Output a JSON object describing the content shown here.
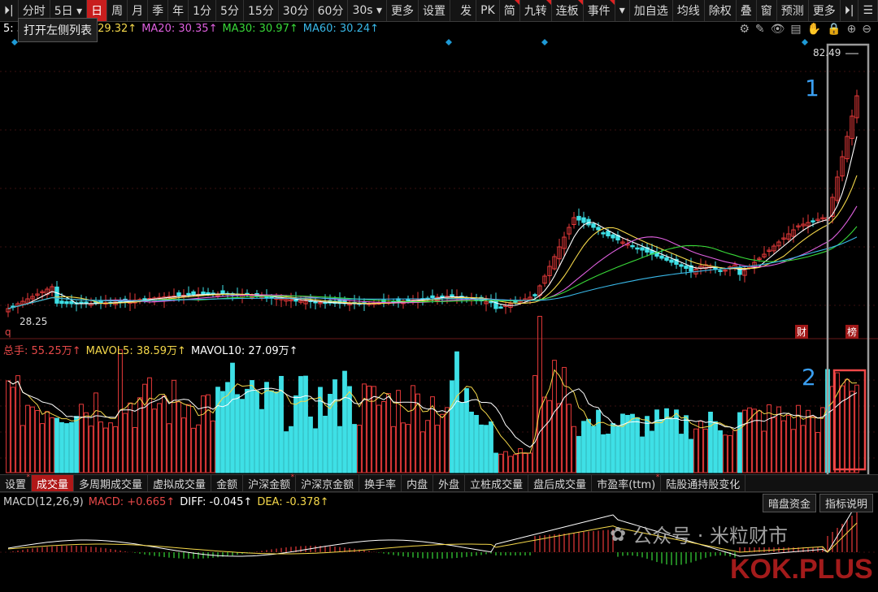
{
  "toolbar": {
    "items": [
      {
        "label": "⏵|",
        "kind": "icon"
      },
      {
        "label": "分时"
      },
      {
        "label": "5日 ▾"
      },
      {
        "label": "日",
        "active": true
      },
      {
        "label": "周"
      },
      {
        "label": "月"
      },
      {
        "label": "季"
      },
      {
        "label": "年"
      },
      {
        "label": "1分"
      },
      {
        "label": "5分"
      },
      {
        "label": "15分"
      },
      {
        "label": "30分"
      },
      {
        "label": "60分"
      },
      {
        "label": "30s ▾"
      },
      {
        "label": "更多"
      },
      {
        "label": "设置"
      }
    ],
    "right_items": [
      {
        "label": "发"
      },
      {
        "label": "PK"
      },
      {
        "label": "简",
        "corner": true
      },
      {
        "label": "九转",
        "corner": true
      },
      {
        "label": "连板",
        "corner": true
      },
      {
        "label": "事件",
        "corner": true
      },
      {
        "label": "▾"
      },
      {
        "label": "加自选"
      },
      {
        "label": "均线"
      },
      {
        "label": "除权"
      },
      {
        "label": "叠"
      },
      {
        "label": "窗"
      },
      {
        "label": "预测"
      },
      {
        "label": "更多"
      },
      {
        "label": "⏵|"
      },
      {
        "label": "☰"
      }
    ]
  },
  "tooltip": "打开左侧列表",
  "ma_legend": {
    "ma5": "5: 30.60↑",
    "ma10": "MA10: 29.32↑",
    "ma20": "MA20: 30.35↑",
    "ma30": "MA30: 30.97↑",
    "ma60": "MA60: 30.24↑"
  },
  "chart_icons": [
    "⚙",
    "✎",
    "👁",
    "▤",
    "✋",
    "🔒",
    "⊕",
    "⊖"
  ],
  "price": {
    "high_label": "82.49",
    "low_label": "28.25",
    "tag_cai": "财",
    "tag_bang": "榜",
    "low_marker": "q"
  },
  "annotations": {
    "one": "1",
    "two": "2"
  },
  "volume_legend": {
    "total": "总手: 55.25万↑",
    "mavol5": "MAVOL5: 38.59万↑",
    "mavol10": "MAVOL10: 27.09万↑"
  },
  "indicator_tabs": [
    {
      "label": "设置",
      "dot": true
    },
    {
      "label": "成交量",
      "active": true
    },
    {
      "label": "多周期成交量"
    },
    {
      "label": "虚拟成交量"
    },
    {
      "label": "金额"
    },
    {
      "label": "沪深金额",
      "dot": true
    },
    {
      "label": "沪深京金额"
    },
    {
      "label": "换手率"
    },
    {
      "label": "内盘"
    },
    {
      "label": "外盘"
    },
    {
      "label": "立桩成交量"
    },
    {
      "label": "盘后成交量"
    },
    {
      "label": "市盈率(ttm)",
      "dot": true
    },
    {
      "label": "陆股通持股变化"
    }
  ],
  "macd_legend": {
    "name": "MACD(12,26,9)",
    "macd": "MACD: +0.665↑",
    "diff": "DIFF: -0.045↑",
    "dea": "DEA: -0.378↑"
  },
  "macd_buttons": [
    "暗盘资金",
    "指标说明"
  ],
  "watermark": {
    "text": "公众号 · 米粒财市",
    "logo": "KOK.PLUS"
  },
  "colors": {
    "up": "#e83a3a",
    "down": "#3ee0e6",
    "ma5": "#ffffff",
    "ma10": "#f5d84a",
    "ma20": "#e060e0",
    "ma30": "#38d838",
    "ma60": "#39b8e8",
    "highlight_box_gray": "#9a9a9a",
    "highlight_box_red": "#f04848"
  }
}
